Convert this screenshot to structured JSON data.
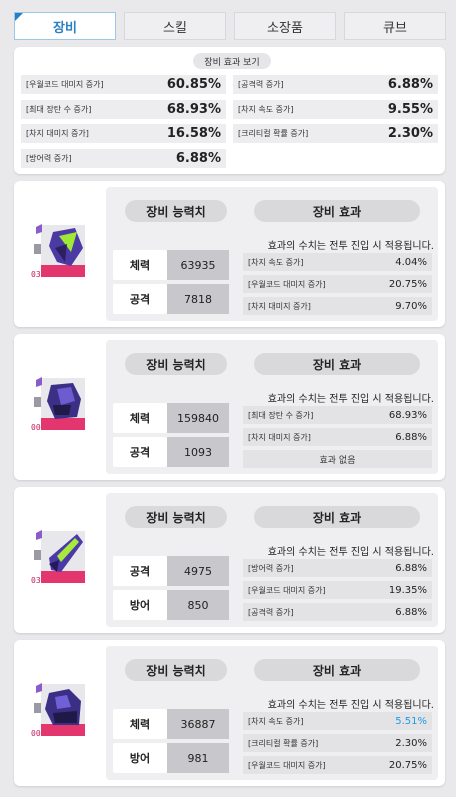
{
  "tabs": [
    {
      "label": "장비",
      "active": true
    },
    {
      "label": "스킬",
      "active": false
    },
    {
      "label": "소장품",
      "active": false
    },
    {
      "label": "큐브",
      "active": false
    }
  ],
  "summary": {
    "title": "장비 효과 보기",
    "left": [
      {
        "label": "[우월코드 대미지 증가]",
        "value": "60.85%"
      },
      {
        "label": "[최대 장탄 수 증가]",
        "value": "68.93%"
      },
      {
        "label": "[차지 대미지 증가]",
        "value": "16.58%"
      },
      {
        "label": "[방어력 증가]",
        "value": "6.88%"
      }
    ],
    "right": [
      {
        "label": "[공격력 증가]",
        "value": "6.88%"
      },
      {
        "label": "[차지 속도 증가]",
        "value": "9.55%"
      },
      {
        "label": "[크리티컬 확률 증가]",
        "value": "2.30%"
      }
    ]
  },
  "labels": {
    "stats_header": "장비 능력치",
    "effects_header": "장비 효과",
    "note": "효과의 수치는 전투 진입 시 적용됩니다."
  },
  "equipment": [
    {
      "level": "03",
      "stats": [
        {
          "label": "체력",
          "value": "63935"
        },
        {
          "label": "공격",
          "value": "7818"
        }
      ],
      "effects": [
        {
          "label": "[차지 속도 증가]",
          "value": "4.04%"
        },
        {
          "label": "[우월코드 대미지 증가]",
          "value": "20.75%"
        },
        {
          "label": "[차지 대미지 증가]",
          "value": "9.70%"
        }
      ]
    },
    {
      "level": "00",
      "stats": [
        {
          "label": "체력",
          "value": "159840"
        },
        {
          "label": "공격",
          "value": "1093"
        }
      ],
      "effects": [
        {
          "label": "[최대 장탄 수 증가]",
          "value": "68.93%"
        },
        {
          "label": "[차지 대미지 증가]",
          "value": "6.88%"
        },
        {
          "label": "효과 없음",
          "value": "",
          "empty": true
        }
      ]
    },
    {
      "level": "03",
      "stats": [
        {
          "label": "공격",
          "value": "4975"
        },
        {
          "label": "방어",
          "value": "850"
        }
      ],
      "effects": [
        {
          "label": "[방어력 증가]",
          "value": "6.88%"
        },
        {
          "label": "[우월코드 대미지 증가]",
          "value": "19.35%"
        },
        {
          "label": "[공격력 증가]",
          "value": "6.88%"
        }
      ]
    },
    {
      "level": "00",
      "stats": [
        {
          "label": "체력",
          "value": "36887"
        },
        {
          "label": "방어",
          "value": "981"
        }
      ],
      "effects": [
        {
          "label": "[차지 속도 증가]",
          "value": "5.51%",
          "highlight": true
        },
        {
          "label": "[크리티컬 확률 증가]",
          "value": "2.30%"
        },
        {
          "label": "[우월코드 대미지 증가]",
          "value": "20.75%"
        }
      ]
    }
  ],
  "colors": {
    "accent": "#2a7fc0",
    "highlight_value": "#1e9be0",
    "level_text": "#c21e5e"
  }
}
